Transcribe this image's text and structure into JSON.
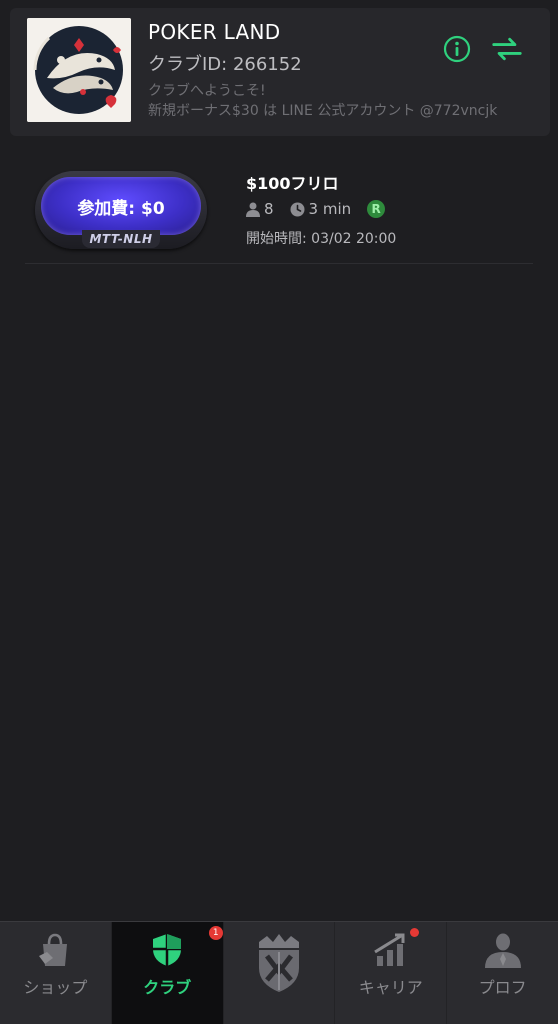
{
  "club": {
    "name": "POKER LAND",
    "id_label": "クラブID: 266152",
    "welcome_line1": "クラブへようこそ!",
    "welcome_line2": "新規ボーナス$30 は LINE 公式アカウント @772vncjk",
    "logo_icon": "koi-fish-logo",
    "info_icon": "info-icon",
    "switch_icon": "swap-arrows-icon",
    "accent_color": "#2fd17e"
  },
  "tournament": {
    "entry_label": "参加費: $0",
    "game_type": "MTT-NLH",
    "name": "$100フリロ",
    "players": "8",
    "duration": "3 min",
    "badge": "R",
    "start_time": "開始時間: 03/02 20:00"
  },
  "nav": {
    "items": [
      {
        "label": "ショップ",
        "icon": "shopping-bag-icon"
      },
      {
        "label": "クラブ",
        "icon": "shield-icon",
        "badge": "1",
        "active": true
      },
      {
        "label": "",
        "icon": "crown-emblem-icon"
      },
      {
        "label": "キャリア",
        "icon": "career-chart-icon",
        "dot": true
      },
      {
        "label": "プロフ",
        "icon": "profile-icon"
      }
    ]
  }
}
